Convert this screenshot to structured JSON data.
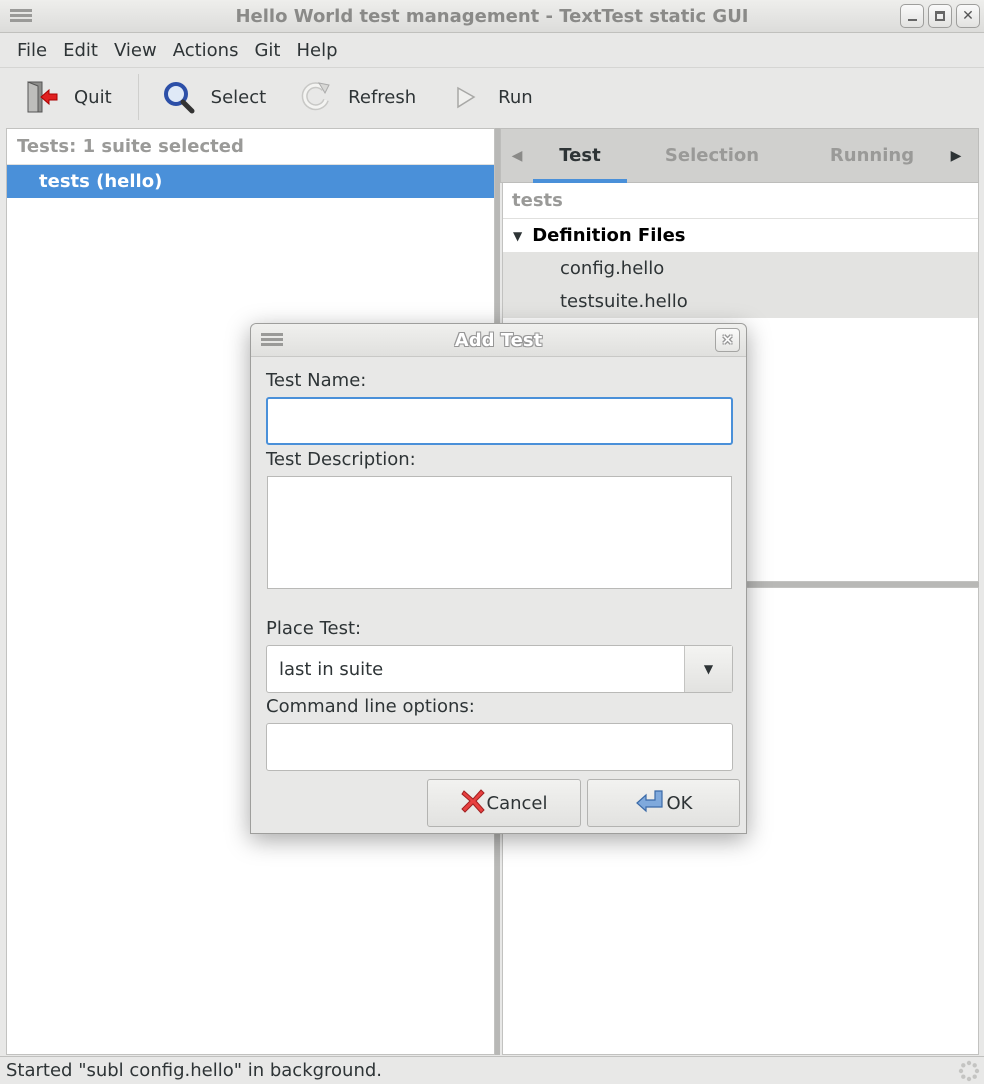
{
  "window": {
    "title": "Hello World test management - TextTest static GUI",
    "controls": [
      "minimize",
      "maximize",
      "close"
    ]
  },
  "menubar": {
    "items": [
      "File",
      "Edit",
      "View",
      "Actions",
      "Git",
      "Help"
    ]
  },
  "toolbar": {
    "quit": {
      "label": "Quit",
      "icon": "exit-door-icon"
    },
    "select": {
      "label": "Select",
      "icon": "magnifier-icon"
    },
    "refresh": {
      "label": "Refresh",
      "icon": "refresh-icon"
    },
    "run": {
      "label": "Run",
      "icon": "play-icon"
    }
  },
  "test_tree": {
    "header": "Tests: 1 suite selected",
    "rows": [
      {
        "label": "tests (hello)",
        "selected": true
      }
    ]
  },
  "right_panel": {
    "tabs": [
      {
        "label": "Test",
        "active": true
      },
      {
        "label": "Selection",
        "active": false
      },
      {
        "label": "Running",
        "active": false
      }
    ],
    "info_header": "tests",
    "groups": [
      {
        "label": "Definition Files",
        "expanded": true,
        "files": [
          "config.hello",
          "testsuite.hello"
        ]
      }
    ]
  },
  "dialog": {
    "title": "Add Test",
    "test_name_label": "Test Name:",
    "test_name_value": "",
    "test_description_label": "Test Description:",
    "test_description_value": "",
    "place_test_label": "Place Test:",
    "place_test_value": "last in suite",
    "command_line_label": "Command line options:",
    "command_line_value": "",
    "cancel_label": "Cancel",
    "ok_label": "OK"
  },
  "statusbar": {
    "message": "Started \"subl config.hello\" in background."
  },
  "colors": {
    "accent": "#4a90d9",
    "selection_text": "#ffffff",
    "window_bg": "#e8e8e7"
  }
}
